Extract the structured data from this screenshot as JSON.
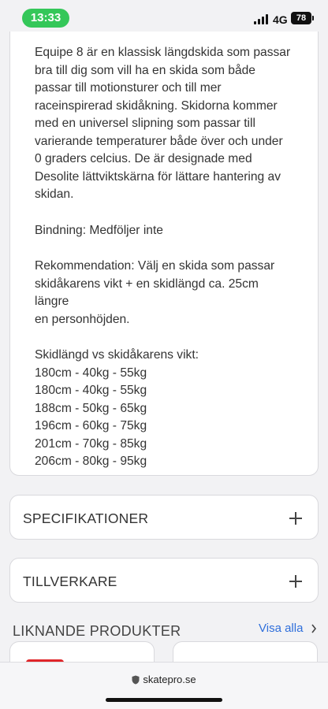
{
  "status_bar": {
    "time": "13:33",
    "network": "4G",
    "battery": "78"
  },
  "description": {
    "paragraph1": [
      "Equipe 8 är en klassisk längdskida som passar",
      "bra till dig som vill ha en skida som både",
      "passar till motionsturer och till mer",
      "raceinspirerad skidåkning. Skidorna kommer",
      "med en universel slipning som passar till",
      "varierande temperaturer både över och under",
      "0 graders celcius. De är designade med",
      "Desolite lättviktskärna för lättare hantering av",
      "skidan."
    ],
    "binding": "Bindning: Medföljer inte",
    "recommendation": [
      "Rekommendation: Välj en skida som passar",
      "skidåkarens vikt + en skidlängd ca. 25cm längre",
      "en personhöjden."
    ],
    "size_table_header": "Skidlängd vs skidåkarens vikt:",
    "size_rows": [
      "180cm - 40kg - 55kg",
      "180cm - 40kg - 55kg",
      "188cm - 50kg - 65kg",
      "196cm - 60kg - 75kg",
      "201cm - 70kg - 85kg",
      "206cm - 80kg - 95kg"
    ]
  },
  "accordions": {
    "specs": "SPECIFIKATIONER",
    "manufacturer": "TILLVERKARE"
  },
  "similar": {
    "title": "LIKNANDE PRODUKTER",
    "see_all": "Visa alla"
  },
  "browser": {
    "url": "skatepro.se"
  },
  "colors": {
    "time_pill": "#34c759",
    "link": "#2f6fdb",
    "product_red": "#e0262a"
  }
}
